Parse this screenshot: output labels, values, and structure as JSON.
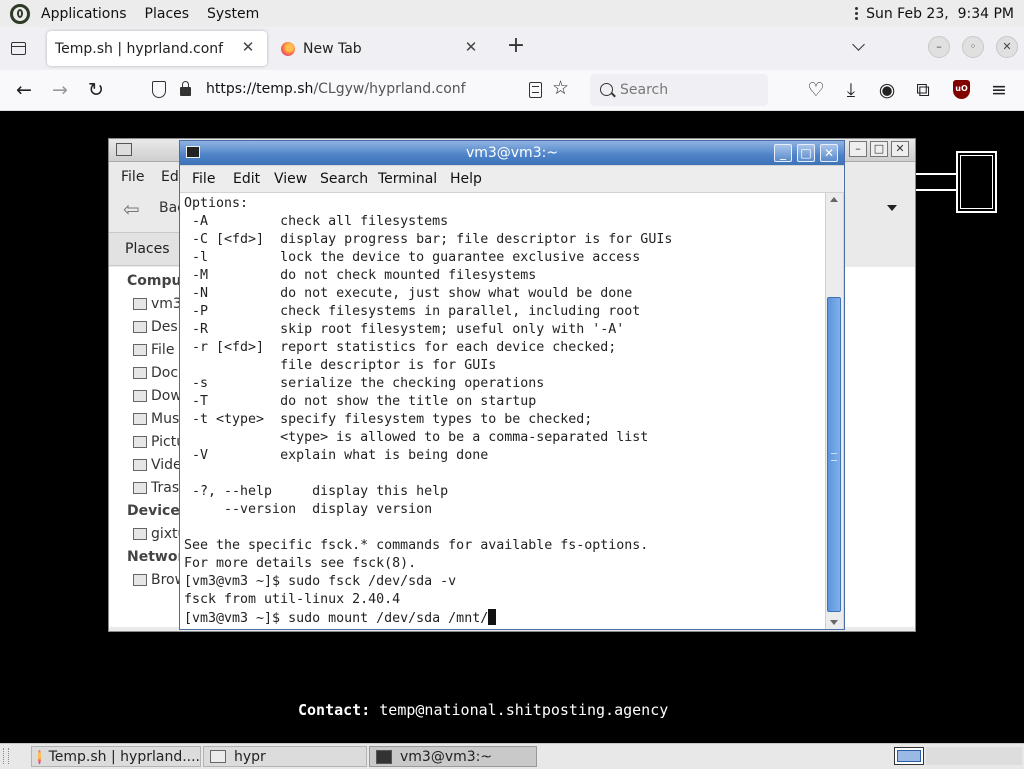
{
  "top_panel": {
    "menus": [
      "Applications",
      "Places",
      "System"
    ],
    "clock": "Sun Feb 23,  9:34 PM"
  },
  "browser": {
    "tabs": [
      {
        "title": "Temp.sh | hyprland.conf",
        "active": true
      },
      {
        "title": "New Tab",
        "active": false
      }
    ],
    "url_host": "https://temp.sh",
    "url_path": "/CLgyw/hyprland.conf",
    "search_placeholder": "Search",
    "ublock_label": "uO"
  },
  "page": {
    "contact_label": "Contact:",
    "contact_email": "temp@national.shitposting.agency"
  },
  "file_manager": {
    "menus": [
      "File",
      "Edi"
    ],
    "back_label": "Bac",
    "places_label": "Places",
    "sections": [
      {
        "heading": "Compute",
        "items": [
          "vm3",
          "Desk",
          "File S",
          "Docu",
          "Dow",
          "Musi",
          "Pictu",
          "Vide",
          "Trasl"
        ]
      },
      {
        "heading": "Devices",
        "items": [
          "gixtu"
        ]
      },
      {
        "heading": "Network",
        "items": [
          "Brow"
        ]
      }
    ]
  },
  "terminal": {
    "title": "vm3@vm3:~",
    "menus": [
      "File",
      "Edit",
      "View",
      "Search",
      "Terminal",
      "Help"
    ],
    "lines": [
      "Options:",
      " -A         check all filesystems",
      " -C [<fd>]  display progress bar; file descriptor is for GUIs",
      " -l         lock the device to guarantee exclusive access",
      " -M         do not check mounted filesystems",
      " -N         do not execute, just show what would be done",
      " -P         check filesystems in parallel, including root",
      " -R         skip root filesystem; useful only with '-A'",
      " -r [<fd>]  report statistics for each device checked;",
      "            file descriptor is for GUIs",
      " -s         serialize the checking operations",
      " -T         do not show the title on startup",
      " -t <type>  specify filesystem types to be checked;",
      "            <type> is allowed to be a comma-separated list",
      " -V         explain what is being done",
      "",
      " -?, --help     display this help",
      "     --version  display version",
      "",
      "See the specific fsck.* commands for available fs-options.",
      "For more details see fsck(8).",
      "[vm3@vm3 ~]$ sudo fsck /dev/sda -v",
      "fsck from util-linux 2.40.4"
    ],
    "prompt_line": "[vm3@vm3 ~]$ sudo mount /dev/sda /mnt/"
  },
  "taskbar": {
    "items": [
      "Temp.sh | hyprland....",
      "hypr",
      "vm3@vm3:~"
    ]
  }
}
